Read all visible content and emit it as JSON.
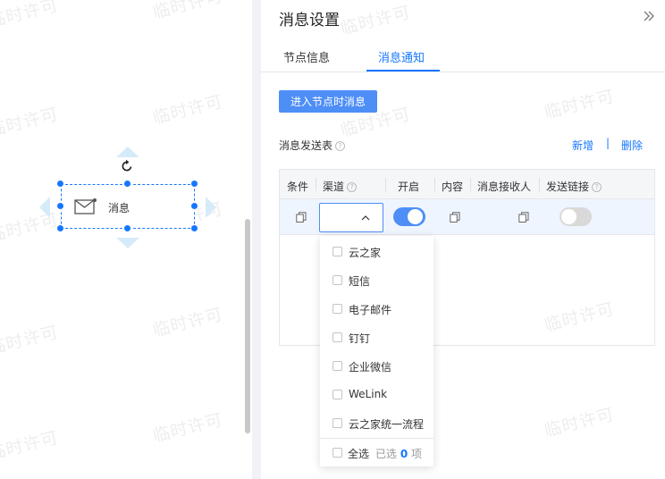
{
  "canvas": {
    "node_label": "消息"
  },
  "watermark": "临时许可",
  "panel": {
    "title": "消息设置",
    "tabs": [
      {
        "label": "节点信息",
        "active": false
      },
      {
        "label": "消息通知",
        "active": true
      }
    ],
    "enter_button": "进入节点时消息",
    "send_table_label": "消息发送表",
    "add_link": "新增",
    "separator": "|",
    "delete_link": "删除",
    "table": {
      "headers": [
        "条件",
        "渠道",
        "开启",
        "内容",
        "消息接收人",
        "发送链接"
      ],
      "rows": [
        {
          "channel": "",
          "enabled": true,
          "send_link": false
        }
      ]
    }
  },
  "dropdown": {
    "options": [
      "云之家",
      "短信",
      "电子邮件",
      "钉钉",
      "企业微信",
      "WeLink",
      "云之家统一流程"
    ],
    "select_all": "全选",
    "selected_prefix": "已选",
    "selected_count": "0",
    "selected_suffix": "项"
  },
  "colors": {
    "primary": "#1677ff",
    "button": "#4e8ef7",
    "row_highlight": "#eef5fe",
    "header_bg": "#f5f6f8"
  }
}
